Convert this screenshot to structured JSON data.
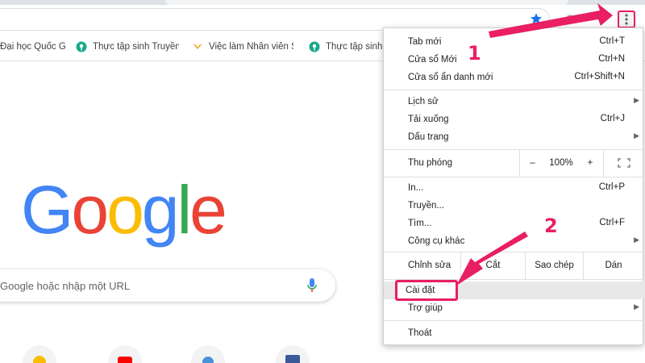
{
  "colors": {
    "accent": "#e91e63",
    "google_blue": "#4285f4",
    "google_red": "#ea4335",
    "google_yellow": "#fbbc05",
    "google_green": "#34a853"
  },
  "bookmarks": [
    {
      "label": "Đại học Quốc Gi",
      "icon": "university-icon"
    },
    {
      "label": "Thực tập sinh Truyền",
      "icon": "location-pin-icon"
    },
    {
      "label": "Việc làm Nhân viên S",
      "icon": "bird-logo-icon"
    },
    {
      "label": "Thực tập sinh",
      "icon": "location-pin-icon"
    }
  ],
  "google": {
    "logo": [
      "G",
      "o",
      "o",
      "g",
      "l",
      "e"
    ],
    "search_placeholder": "Google hoặc nhập một URL"
  },
  "menu": {
    "new_tab": {
      "label": "Tab mới",
      "shortcut": "Ctrl+T"
    },
    "new_window": {
      "label": "Cửa sổ Mới",
      "shortcut": "Ctrl+N"
    },
    "incognito": {
      "label": "Cửa sổ ẩn danh mới",
      "shortcut": "Ctrl+Shift+N"
    },
    "history": {
      "label": "Lịch sử"
    },
    "downloads": {
      "label": "Tải xuống",
      "shortcut": "Ctrl+J"
    },
    "bookmarks": {
      "label": "Dấu trang"
    },
    "zoom": {
      "label": "Thu phóng",
      "minus": "–",
      "value": "100%",
      "plus": "+"
    },
    "print": {
      "label": "In...",
      "shortcut": "Ctrl+P"
    },
    "cast": {
      "label": "Truyền..."
    },
    "find": {
      "label": "Tìm...",
      "shortcut": "Ctrl+F"
    },
    "more_tools": {
      "label": "Công cụ khác"
    },
    "edit": {
      "label": "Chỉnh sửa",
      "cut": "Cắt",
      "copy": "Sao chép",
      "paste": "Dán"
    },
    "settings": {
      "label": "Cài đặt"
    },
    "help": {
      "label": "Trợ giúp"
    },
    "exit": {
      "label": "Thoát"
    }
  },
  "annotations": {
    "step1": "1",
    "step2": "2"
  }
}
